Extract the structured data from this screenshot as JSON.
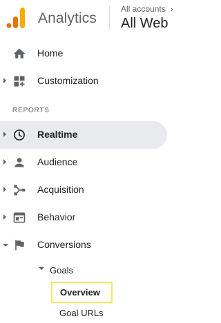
{
  "header": {
    "app_name": "Analytics",
    "account_caption": "All accounts",
    "account_chevron": "›",
    "account_name": "All Web",
    "logo_colors": [
      "#f9ab00",
      "#e37400"
    ]
  },
  "nav": {
    "reports_heading": "REPORTS",
    "items": [
      {
        "id": "home",
        "label": "Home",
        "icon": "home-icon",
        "caret": "none"
      },
      {
        "id": "customization",
        "label": "Customization",
        "icon": "dashboard-add-icon",
        "caret": "collapsed"
      },
      {
        "id": "realtime",
        "label": "Realtime",
        "icon": "clock-icon",
        "caret": "collapsed",
        "active": true
      },
      {
        "id": "audience",
        "label": "Audience",
        "icon": "person-icon",
        "caret": "collapsed"
      },
      {
        "id": "acquisition",
        "label": "Acquisition",
        "icon": "branch-icon",
        "caret": "collapsed"
      },
      {
        "id": "behavior",
        "label": "Behavior",
        "icon": "browser-window-icon",
        "caret": "collapsed"
      },
      {
        "id": "conversions",
        "label": "Conversions",
        "icon": "flag-icon",
        "caret": "expanded"
      }
    ],
    "conversions_children": {
      "goals_label": "Goals",
      "goals_children": [
        "Overview",
        "Goal URLs"
      ],
      "selected": "Overview",
      "highlight_color": "#f2ea5c"
    }
  },
  "colors": {
    "text": "#202124",
    "icon": "#5f6368",
    "active_bg": "#e8eaed"
  }
}
